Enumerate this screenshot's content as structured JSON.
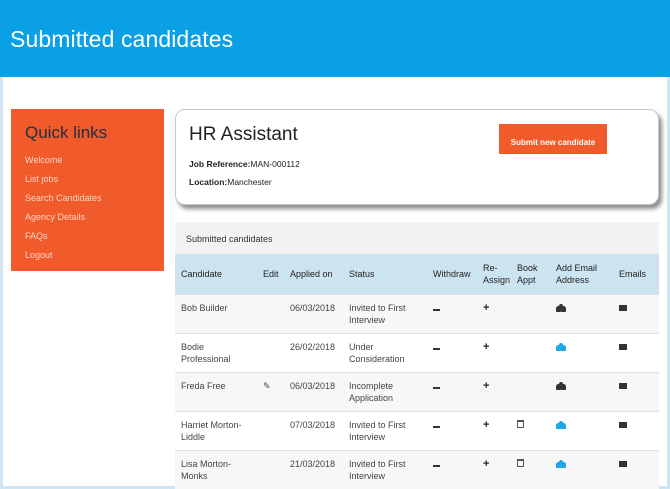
{
  "header": {
    "title": "Submitted candidates"
  },
  "quick_links": {
    "heading": "Quick links",
    "items": [
      "Welcome",
      "List jobs",
      "Search Candidates",
      "Agency Details",
      "FAQs",
      "Logout"
    ]
  },
  "job": {
    "title": "HR Assistant",
    "reference_label": "Job Reference:",
    "reference_value": "MAN-000112",
    "location_label": "Location:",
    "location_value": "Manchester",
    "submit_button": "Submit new candidate"
  },
  "table": {
    "title": "Submitted candidates",
    "columns": [
      "Candidate",
      "Edit",
      "Applied on",
      "Status",
      "Withdraw",
      "Re-Assign",
      "Book Appt",
      "Add Email Address",
      "Emails"
    ],
    "rows": [
      {
        "candidate": "Bob Builder",
        "edit": false,
        "applied_on": "06/03/2018",
        "status": "Invited to First Interview",
        "book_appt": false,
        "email_icon_color": "#333333"
      },
      {
        "candidate": "Bodie Professional",
        "edit": false,
        "applied_on": "26/02/2018",
        "status": "Under Consideration",
        "book_appt": false,
        "email_icon_color": "#1ea7e8"
      },
      {
        "candidate": "Freda Free",
        "edit": true,
        "applied_on": "06/03/2018",
        "status": "Incomplete Application",
        "book_appt": false,
        "email_icon_color": "#333333"
      },
      {
        "candidate": "Harriet Morton-Liddle",
        "edit": false,
        "applied_on": "07/03/2018",
        "status": "Invited to First Interview",
        "book_appt": true,
        "email_icon_color": "#1ea7e8"
      },
      {
        "candidate": "Lisa Morton-Monks",
        "edit": false,
        "applied_on": "21/03/2018",
        "status": "Invited to First Interview",
        "book_appt": true,
        "email_icon_color": "#1ea7e8"
      }
    ]
  },
  "colors": {
    "header_bg": "#0aa0e6",
    "accent_orange": "#f15a2b",
    "table_header_bg": "#cce4f0"
  }
}
